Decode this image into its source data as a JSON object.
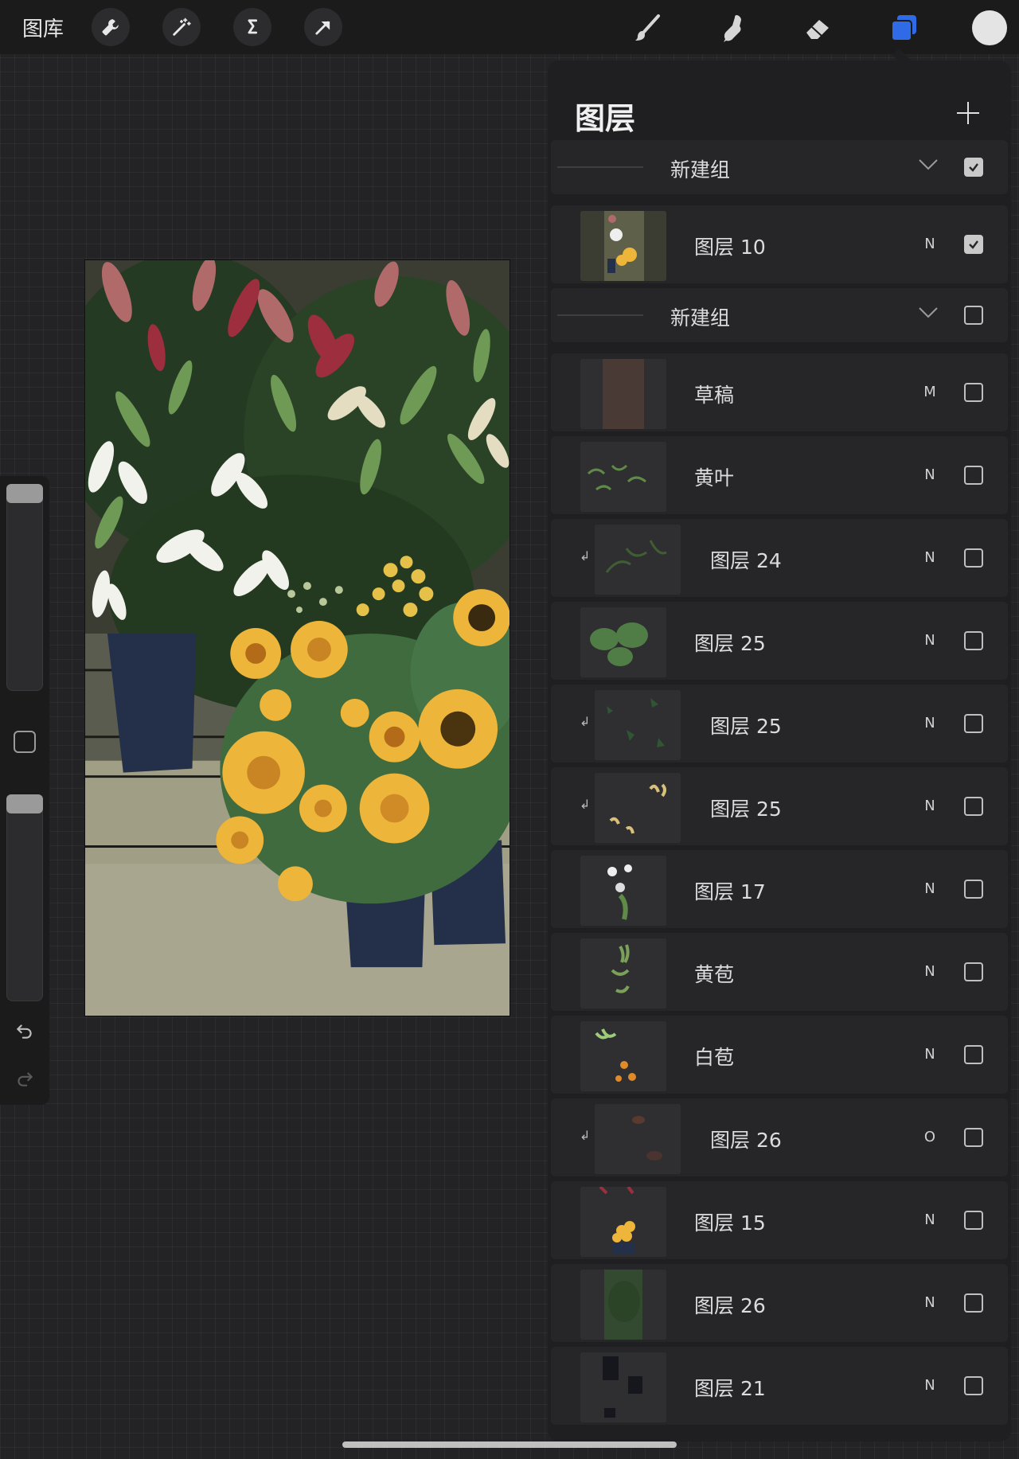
{
  "toolbar": {
    "gallery_label": "图库",
    "tools_left": [
      "wrench-icon",
      "magic-wand-icon",
      "selection-s-icon",
      "arrow-icon"
    ],
    "tools_right": [
      "brush-icon",
      "smudge-icon",
      "eraser-icon",
      "layers-icon"
    ],
    "accent_color": "#2f6be6",
    "current_color": "#e4e4e4"
  },
  "layers_panel": {
    "title": "图层",
    "rows": [
      {
        "type": "group",
        "name": "新建组",
        "checked": true
      },
      {
        "type": "layer",
        "name": "图层 10",
        "mode": "N",
        "checked": true,
        "clipped": false
      },
      {
        "type": "group",
        "name": "新建组",
        "checked": false
      },
      {
        "type": "layer",
        "name": "草稿",
        "mode": "M",
        "checked": false,
        "clipped": false
      },
      {
        "type": "layer",
        "name": "黄叶",
        "mode": "N",
        "checked": false,
        "clipped": false
      },
      {
        "type": "layer",
        "name": "图层 24",
        "mode": "N",
        "checked": false,
        "clipped": true
      },
      {
        "type": "layer",
        "name": "图层 25",
        "mode": "N",
        "checked": false,
        "clipped": false
      },
      {
        "type": "layer",
        "name": "图层 25",
        "mode": "N",
        "checked": false,
        "clipped": true
      },
      {
        "type": "layer",
        "name": "图层 25",
        "mode": "N",
        "checked": false,
        "clipped": true
      },
      {
        "type": "layer",
        "name": "图层 17",
        "mode": "N",
        "checked": false,
        "clipped": false
      },
      {
        "type": "layer",
        "name": "黄苞",
        "mode": "N",
        "checked": false,
        "clipped": false
      },
      {
        "type": "layer",
        "name": "白苞",
        "mode": "N",
        "checked": false,
        "clipped": false
      },
      {
        "type": "layer",
        "name": "图层 26",
        "mode": "O",
        "checked": false,
        "clipped": true
      },
      {
        "type": "layer",
        "name": "图层 15",
        "mode": "N",
        "checked": false,
        "clipped": false
      },
      {
        "type": "layer",
        "name": "图层 26",
        "mode": "N",
        "checked": false,
        "clipped": false
      },
      {
        "type": "layer",
        "name": "图层 21",
        "mode": "N",
        "checked": false,
        "clipped": false
      }
    ]
  }
}
